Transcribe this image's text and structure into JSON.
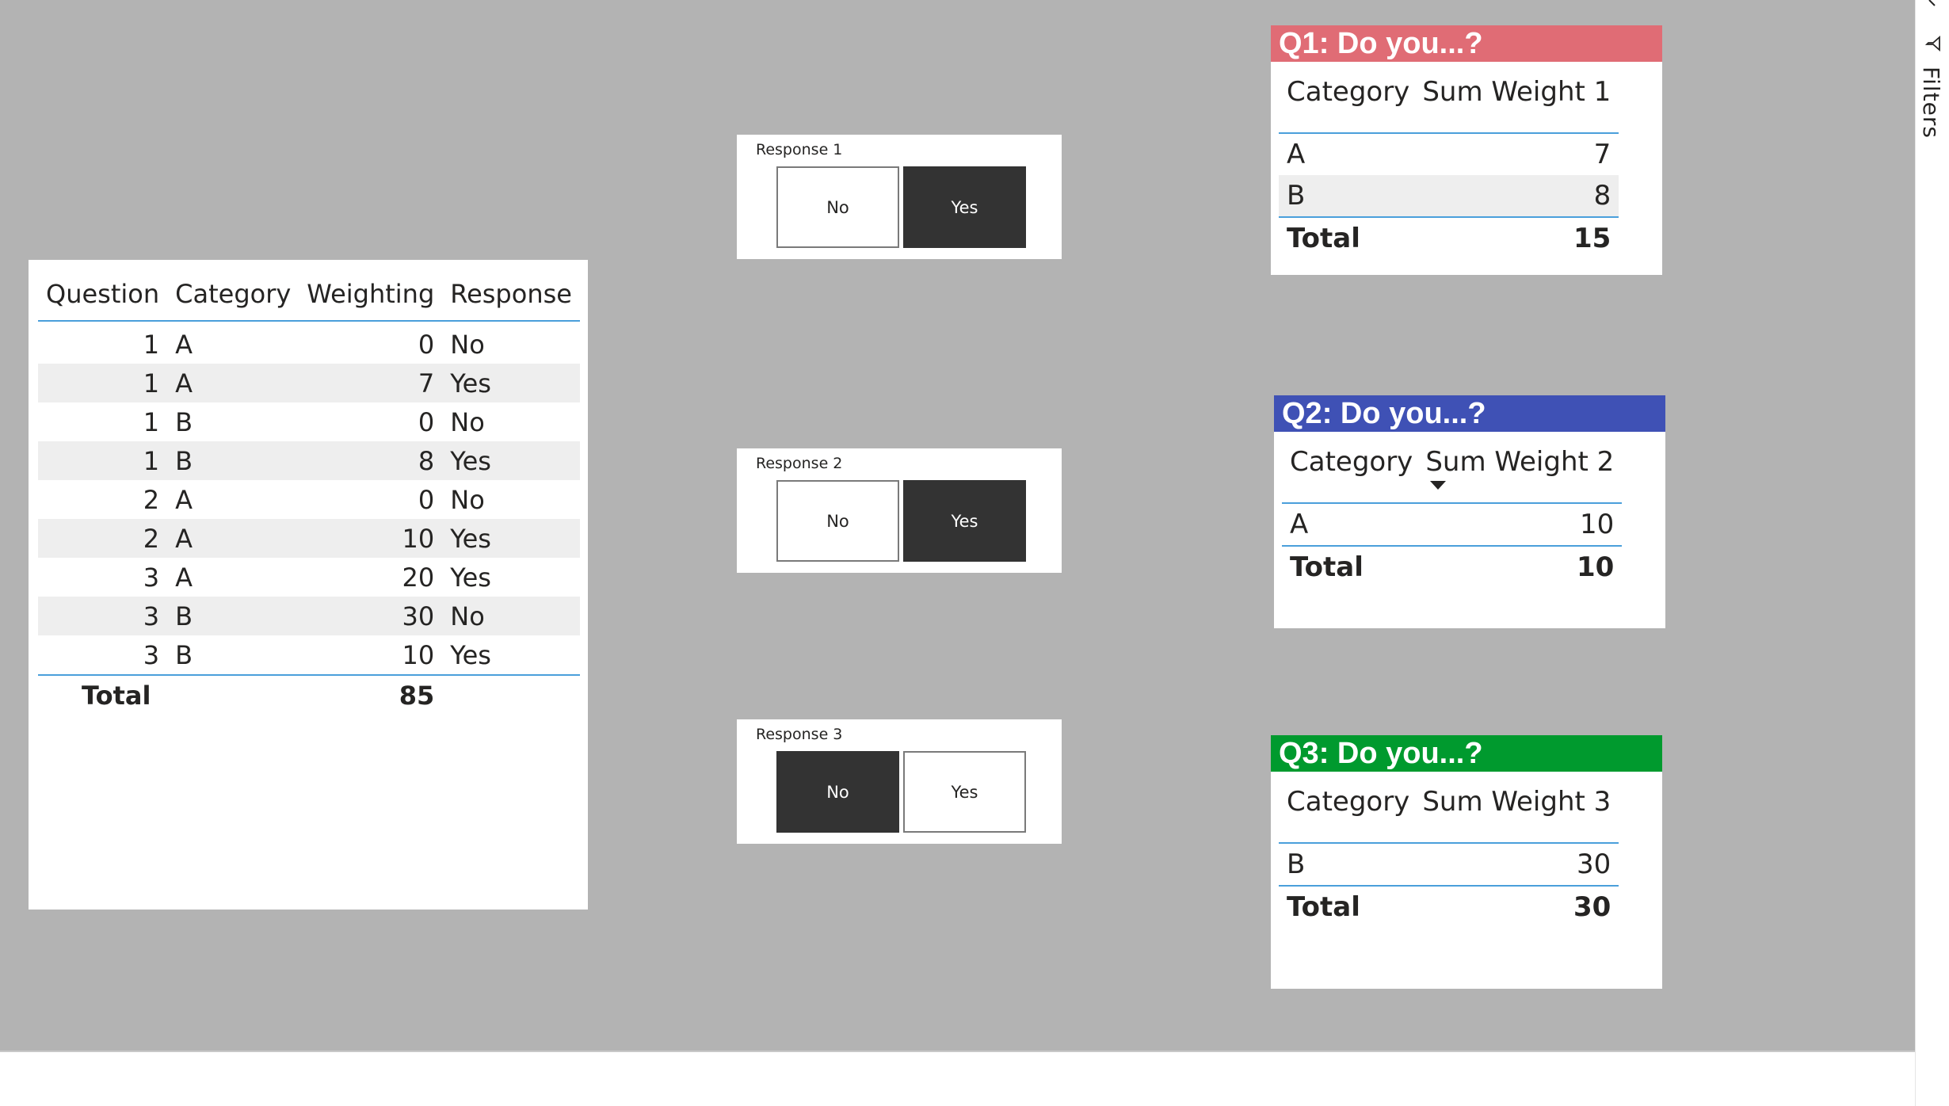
{
  "colors": {
    "canvas_bg": "#b3b3b3",
    "q1_header": "#e06c75",
    "q2_header": "#3f51b5",
    "q3_header": "#009a2e",
    "accent_line": "#4a9fdb",
    "slicer_selected": "#333333"
  },
  "filters_pane": {
    "label": "Filters",
    "icon": "filter-icon"
  },
  "main_table": {
    "headers": [
      "Question",
      "Category",
      "Weighting",
      "Response"
    ],
    "rows": [
      {
        "question": "1",
        "category": "A",
        "weighting": "0",
        "response": "No"
      },
      {
        "question": "1",
        "category": "A",
        "weighting": "7",
        "response": "Yes"
      },
      {
        "question": "1",
        "category": "B",
        "weighting": "0",
        "response": "No"
      },
      {
        "question": "1",
        "category": "B",
        "weighting": "8",
        "response": "Yes"
      },
      {
        "question": "2",
        "category": "A",
        "weighting": "0",
        "response": "No"
      },
      {
        "question": "2",
        "category": "A",
        "weighting": "10",
        "response": "Yes"
      },
      {
        "question": "3",
        "category": "A",
        "weighting": "20",
        "response": "Yes"
      },
      {
        "question": "3",
        "category": "B",
        "weighting": "30",
        "response": "No"
      },
      {
        "question": "3",
        "category": "B",
        "weighting": "10",
        "response": "Yes"
      }
    ],
    "total_label": "Total",
    "total_value": "85"
  },
  "slicers": [
    {
      "title": "Response 1",
      "options": [
        "No",
        "Yes"
      ],
      "selected": "Yes"
    },
    {
      "title": "Response 2",
      "options": [
        "No",
        "Yes"
      ],
      "selected": "Yes"
    },
    {
      "title": "Response 3",
      "options": [
        "No",
        "Yes"
      ],
      "selected": "No"
    }
  ],
  "summaries": [
    {
      "title": "Q1: Do you...?",
      "col_category": "Category",
      "col_value": "Sum Weight 1",
      "rows": [
        {
          "category": "A",
          "value": "7"
        },
        {
          "category": "B",
          "value": "8"
        }
      ],
      "total_label": "Total",
      "total_value": "15"
    },
    {
      "title": "Q2: Do you...?",
      "col_category": "Category",
      "col_value": "Sum Weight 2",
      "rows": [
        {
          "category": "A",
          "value": "10"
        }
      ],
      "total_label": "Total",
      "total_value": "10"
    },
    {
      "title": "Q3: Do you...?",
      "col_category": "Category",
      "col_value": "Sum Weight 3",
      "rows": [
        {
          "category": "B",
          "value": "30"
        }
      ],
      "total_label": "Total",
      "total_value": "30"
    }
  ]
}
